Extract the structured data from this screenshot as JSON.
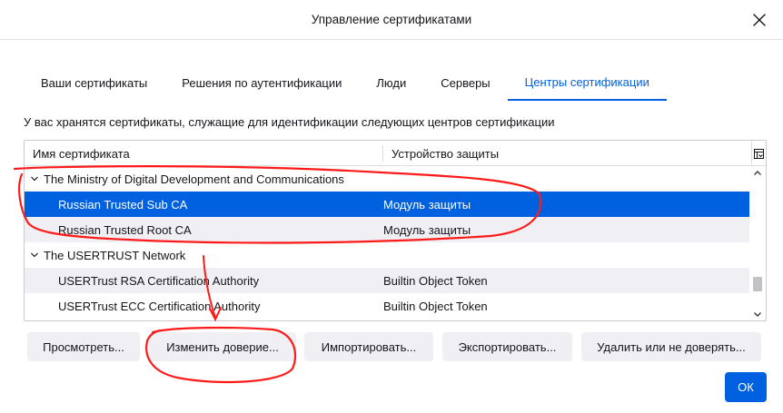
{
  "dialog": {
    "title": "Управление сертификатами",
    "close_icon": "close-icon"
  },
  "tabs": [
    {
      "label": "Ваши сертификаты",
      "active": false
    },
    {
      "label": "Решения по аутентификации",
      "active": false
    },
    {
      "label": "Люди",
      "active": false
    },
    {
      "label": "Серверы",
      "active": false
    },
    {
      "label": "Центры сертификации",
      "active": true
    }
  ],
  "description": "У вас хранятся сертификаты, служащие для идентификации следующих центров сертификации",
  "table": {
    "columns": [
      "Имя сертификата",
      "Устройство защиты"
    ],
    "column_picker_icon": "column-picker-icon",
    "rows": [
      {
        "type": "group",
        "name": "The Ministry of Digital Development and Communications",
        "device": ""
      },
      {
        "type": "child",
        "name": "Russian Trusted Sub CA",
        "device": "Модуль защиты",
        "selected": true
      },
      {
        "type": "child",
        "name": "Russian Trusted Root CA",
        "device": "Модуль защиты"
      },
      {
        "type": "group",
        "name": "The USERTRUST Network",
        "device": ""
      },
      {
        "type": "child",
        "name": "USERTrust RSA Certification Authority",
        "device": "Builtin Object Token"
      },
      {
        "type": "child",
        "name": "USERTrust ECC Certification Authority",
        "device": "Builtin Object Token"
      }
    ]
  },
  "buttons": {
    "view": "Просмотреть...",
    "edit_trust": "Изменить доверие...",
    "import": "Импортировать...",
    "export": "Экспортировать...",
    "delete": "Удалить или не доверять...",
    "ok": "ОК"
  },
  "colors": {
    "accent": "#0061e0",
    "annotation": "#ff1a1a"
  }
}
